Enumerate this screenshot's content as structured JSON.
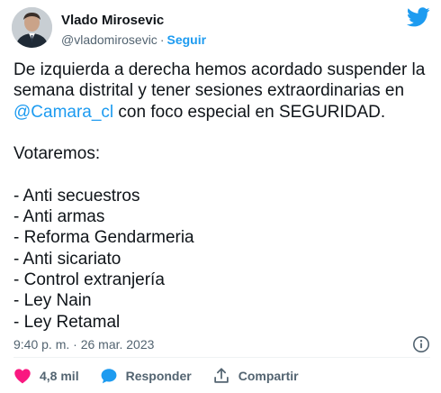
{
  "author": {
    "display_name": "Vlado Mirosevic",
    "handle": "@vladomirosevic",
    "separator": "·",
    "follow_label": "Seguir"
  },
  "tweet": {
    "line_1": "De izquierda a derecha hemos acordado suspender la semana distrital y tener sesiones extraordinarias en ",
    "mention": "@Camara_cl",
    "line_2": " con foco especial en SEGURIDAD.",
    "intro": "Votaremos:",
    "items": [
      "- Anti secuestros",
      "- Anti armas",
      "- Reforma Gendarmeria",
      "- Anti sicariato",
      "- Control extranjería",
      "- Ley Nain",
      "- Ley Retamal"
    ],
    "timestamp": "9:40 p. m. · 26 mar. 2023"
  },
  "actions": {
    "likes_count": "4,8 mil",
    "reply_label": "Responder",
    "share_label": "Compartir"
  },
  "colors": {
    "accent": "#1d9bf0",
    "like_pink": "#f91880",
    "muted": "#536471",
    "text": "#0f1419"
  },
  "icons": {
    "brand": "twitter-bird-icon",
    "info": "info-icon",
    "like": "heart-icon",
    "reply": "speech-bubble-icon",
    "share": "share-upload-icon"
  }
}
